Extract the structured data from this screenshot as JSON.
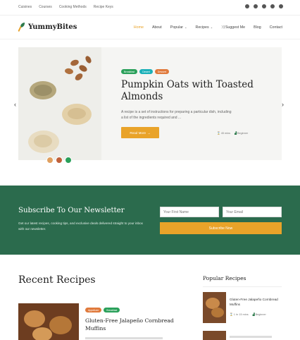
{
  "topbar": {
    "links": [
      "Cuisines",
      "Courses",
      "Cooking Methods",
      "Recipe Keys"
    ],
    "social_icons": [
      "facebook-icon",
      "twitter-icon",
      "instagram-icon",
      "pinterest-icon",
      "youtube-icon"
    ]
  },
  "header": {
    "logo_text": "YummyBites",
    "nav": {
      "home": "Home",
      "about": "About",
      "popular": "Popular",
      "recipes": "Recipes",
      "suggest": "Suggest Me",
      "blog": "Blog",
      "contact": "Contact"
    },
    "accent_color": "#e9a329"
  },
  "hero": {
    "tags": [
      {
        "label": "Breakfast",
        "color": "#2aa05a"
      },
      {
        "label": "Desert",
        "color": "#1bb0b8"
      },
      {
        "label": "Dessert",
        "color": "#e07a3c"
      }
    ],
    "title": "Pumpkin Oats with Toasted Almonds",
    "excerpt": "A recipe is a set of instructions for preparing a particular dish, including a list of the ingredients required and ...",
    "button": "Read More",
    "meta_time": "45 mins",
    "meta_level": "Beginner",
    "prev_arrow": "‹",
    "next_arrow": "›"
  },
  "newsletter": {
    "title": "Subscribe To Our Newsletter",
    "text": "Get our latest recipes, cooking tips, and exclusive deals delivered straight to your inbox with our newsletter.",
    "first_name_placeholder": "Your First Name",
    "email_placeholder": "Your Email",
    "button": "Subscribe Now",
    "bg_color": "#2b6b4d"
  },
  "recent": {
    "title": "Recent Recipes",
    "card": {
      "tags": [
        {
          "label": "Appetizer",
          "color": "#e07a3c"
        },
        {
          "label": "Breakfast",
          "color": "#2aa05a"
        }
      ],
      "title": "Gluten-Free Jalapeño Cornbread Muffins"
    }
  },
  "popular": {
    "title": "Popular Recipes",
    "item": {
      "title": "Gluten-Free Jalapeño Cornbread Muffins",
      "time": "1 hr 15 mins",
      "level": "Beginner"
    }
  }
}
